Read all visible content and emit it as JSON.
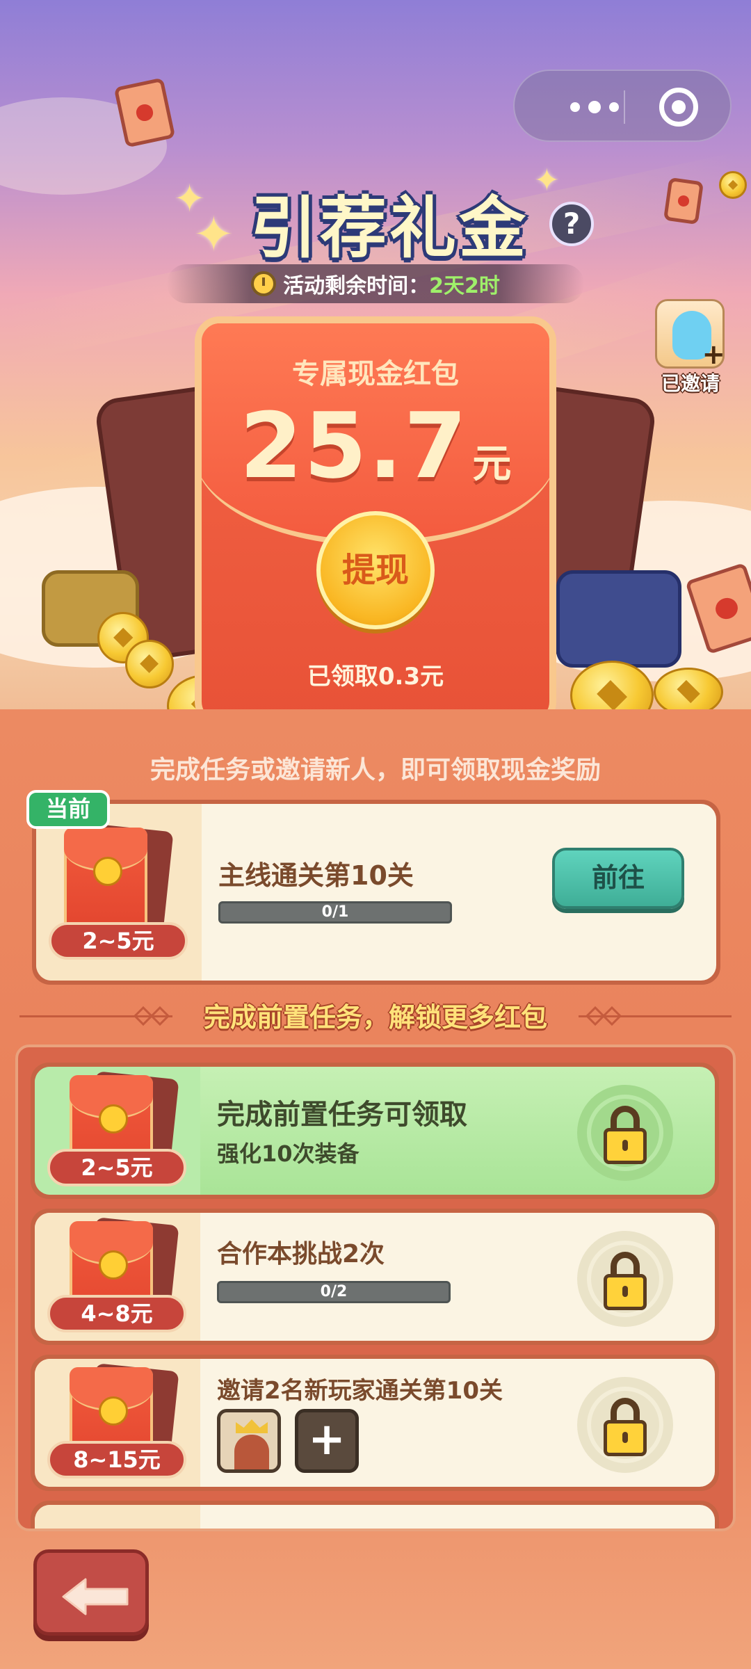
{
  "header": {
    "title": "引荐礼金",
    "help_icon": "question-icon",
    "timer_label": "活动剩余时间：",
    "timer_value": "2天2时",
    "invited_label": "已邀请"
  },
  "envelope": {
    "subtitle": "专属现金红包",
    "amount": "25.7",
    "unit": "元",
    "withdraw_label": "提现",
    "received": "已领取0.3元"
  },
  "hint": "完成任务或邀请新人，即可领取现金奖励",
  "current_task": {
    "tag": "当前",
    "range": "2~5元",
    "title": "主线通关第10关",
    "progress": "0/1",
    "progress_fraction": 0,
    "button": "前往"
  },
  "divider": "完成前置任务，解锁更多红包",
  "locked_tasks": [
    {
      "range": "2~5元",
      "title": "完成前置任务可领取",
      "subtitle": "强化10次装备"
    },
    {
      "range": "4~8元",
      "title": "合作本挑战2次",
      "progress": "0/2",
      "progress_fraction": 0
    },
    {
      "range": "8~15元",
      "title": "邀请2名新玩家通关第10关",
      "add_label": "+"
    }
  ],
  "colors": {
    "accent_red": "#e85237",
    "go_button": "#4fc2ab",
    "unlocked_green": "#b8ebaa",
    "timer_value": "#9ff06a"
  }
}
